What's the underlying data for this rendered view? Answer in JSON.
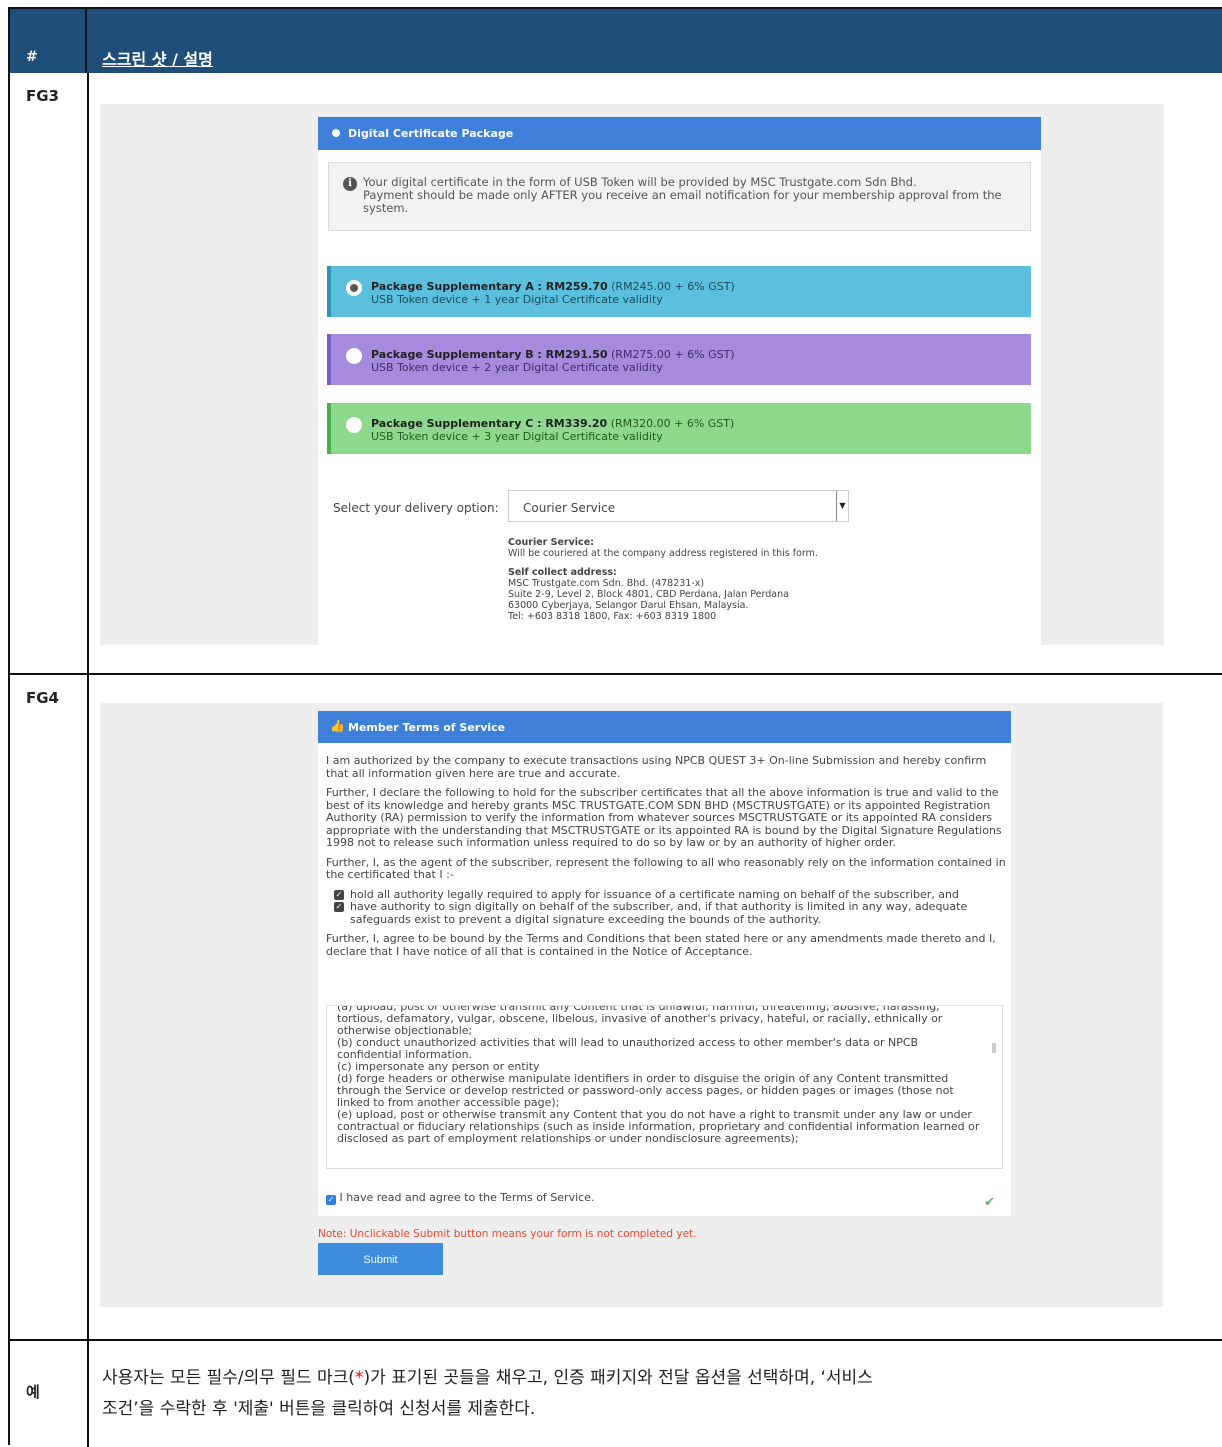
{
  "header": {
    "col_num": "#",
    "col_desc": "스크린 샷 / 설명"
  },
  "rows": {
    "fg3_label": "FG3",
    "fg4_label": "FG4",
    "example_label": "예"
  },
  "fg3": {
    "panel_title": "Digital Certificate Package",
    "info_line1": "Your digital certificate in the form of USB Token will be provided by MSC Trustgate.com Sdn Bhd.",
    "info_line2": "Payment should be made only AFTER you receive an email notification for your membership approval from the system.",
    "packages": [
      {
        "name": "Package Supplementary A : RM259.70",
        "price_detail": " (RM245.00 + 6% GST)",
        "desc": "USB Token device + 1 year Digital Certificate validity",
        "selected": true
      },
      {
        "name": "Package Supplementary B : RM291.50",
        "price_detail": " (RM275.00 + 6% GST)",
        "desc": "USB Token device + 2 year Digital Certificate validity",
        "selected": false
      },
      {
        "name": "Package Supplementary C : RM339.20",
        "price_detail": " (RM320.00 + 6% GST)",
        "desc": "USB Token device + 3 year Digital Certificate validity",
        "selected": false
      }
    ],
    "delivery_label": "Select your delivery option:",
    "delivery_value": "Courier Service",
    "courier_heading": "Courier Service:",
    "courier_text": "Will be couriered at the company address registered in this form.",
    "self_heading": "Self collect address:",
    "self_lines": [
      "MSC Trustgate.com Sdn. Bhd. (478231-x)",
      "Suite 2-9, Level 2, Block 4801, CBD Perdana, Jalan Perdana",
      "63000 Cyberjaya, Selangor Darul Ehsan, Malaysia.",
      "Tel: +603 8318 1800, Fax: +603 8319 1800"
    ]
  },
  "fg4": {
    "panel_title": "Member Terms of Service",
    "p1": "I am authorized by the company to execute transactions using NPCB QUEST 3+ On-line Submission and hereby confirm that all information given here are true and accurate.",
    "p2": "Further, I declare the following to hold for the subscriber certificates that all the above information is true and valid to the best of its knowledge and hereby grants MSC TRUSTGATE.COM SDN BHD (MSCTRUSTGATE) or its appointed Registration Authority (RA) permission to verify the information from whatever sources MSCTRUSTGATE or its appointed RA considers appropriate with the understanding that MSCTRUSTGATE or its appointed RA is bound by the Digital Signature Regulations 1998 not to release such information unless required to do so by law or by an authority of higher order.",
    "p3": "Further, I, as the agent of the subscriber, represent the following to all who reasonably rely on the information contained in the certificated that I :-",
    "check1": "hold all authority legally required to apply for issuance of a certificate naming on behalf of the subscriber, and",
    "check2": "have authority to sign digitally on behalf of the subscriber, and, if that authority is limited in any way, adequate safeguards exist to prevent a digital signature exceeding the bounds of the authority.",
    "p4": "Further, I, agree to be bound by the Terms and Conditions that been stated here or any amendments made thereto and I, declare that I have notice of all that is contained in the Notice of Acceptance.",
    "scroll_lines": [
      "(a) upload, post or otherwise transmit any Content that is unlawful, harmful, threatening, abusive, harassing, tortious, defamatory, vulgar, obscene, libelous, invasive of another's privacy, hateful, or racially, ethnically or otherwise objectionable;",
      "(b) conduct unauthorized activities that will lead to unauthorized access to other member's data or NPCB confidential information.",
      "(c) impersonate any person or entity",
      "(d) forge headers or otherwise manipulate identifiers in order to disguise the origin of any Content transmitted through the Service or develop restricted or password-only access pages, or hidden pages or images (those not linked to from another accessible page);",
      "(e) upload, post or otherwise transmit any Content that you do not have a right to transmit under any law or under contractual or fiduciary relationships (such as inside information, proprietary and confidential information learned or disclosed as part of employment relationships or under nondisclosure agreements);"
    ],
    "agree_label": "I have read and agree to the Terms of Service.",
    "note": "Note: Unclickable Submit button means your form is not completed yet.",
    "submit_label": "Submit"
  },
  "example": {
    "text_before_star": "사용자는 모든 필수/의무 필드 마크(",
    "star": "*",
    "text_after_star": ")가 표기된 곳들을 채우고, 인증 패키지와 전달 옵션을 선택하며, ‘서비스",
    "line2": "조건’을 수락한 후 '제출' 버튼을 클릭하여 신청서를 제출한다."
  },
  "colors": {
    "header_bg": "#1f4e79",
    "panel_head": "#3d7fd9",
    "pkg_a": "#5bc0de",
    "pkg_b": "#a58add",
    "pkg_c": "#8fd98f",
    "note": "#e44b2f",
    "submit": "#3d8bdd"
  },
  "icons": [
    "radio-dot-icon",
    "info-icon",
    "radio-icon",
    "dropdown-arrow-icon",
    "thumbs-up-icon",
    "checkbox-icon",
    "checkmark-icon"
  ]
}
